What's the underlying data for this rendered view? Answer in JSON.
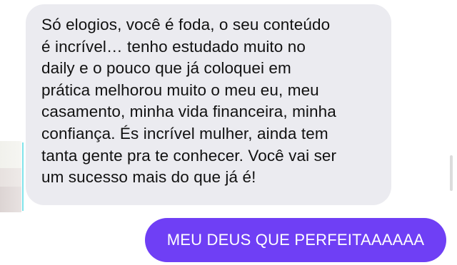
{
  "messages": {
    "received": {
      "text": "Só elogios, você é foda, o seu conteúdo\né incrível… tenho estudado muito no\ndaily e o pouco que já coloquei em\nprática melhorou muito o meu eu, meu\ncasamento, minha vida financeira, minha\nconfiança. És incrível mulher, ainda tem\ntanta gente pra te conhecer. Você vai ser\num sucesso mais do que já é!"
    },
    "sent": {
      "text": "MEU DEUS QUE PERFEITAAAAAA"
    }
  },
  "colors": {
    "received_bubble": "#ebebf0",
    "sent_bubble": "#6f3ff5",
    "sent_text": "#ffffff"
  }
}
